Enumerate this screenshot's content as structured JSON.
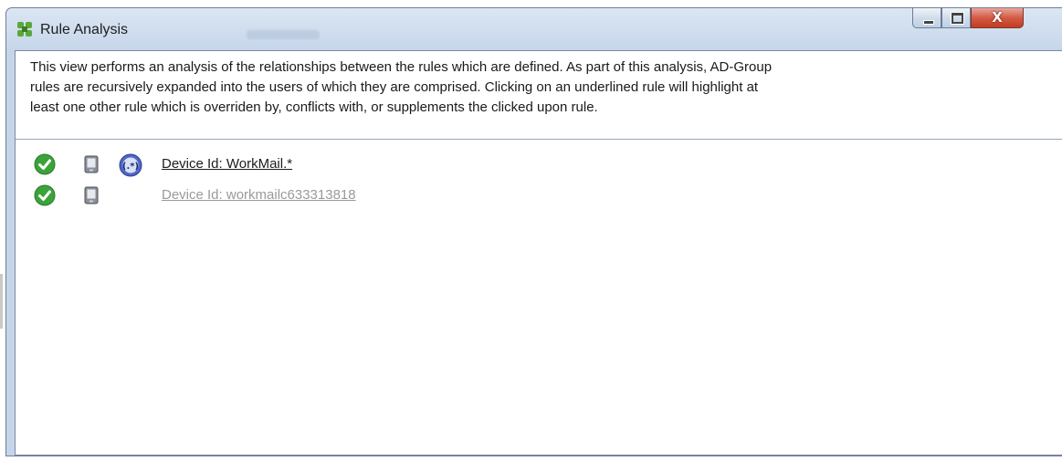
{
  "window": {
    "title": "Rule Analysis",
    "controls": {
      "minimize_icon": "minimize-icon",
      "maximize_icon": "maximize-icon",
      "close_label": "X"
    }
  },
  "description": {
    "lines": [
      "This view performs an analysis of the relationships between the rules which are defined. As part of this analysis, AD-Group",
      "rules are recursively expanded into the users of which they are comprised. Clicking on an underlined rule will highlight at",
      "least one other rule which is overriden by, conflicts with, or supplements the clicked upon rule."
    ]
  },
  "rules": [
    {
      "label": "Device Id: WorkMail.*",
      "status_icon": "check-icon",
      "type_icon": "device-icon",
      "pattern_icon": "regex-icon",
      "highlighted": true
    },
    {
      "label": "Device Id: workmailc633313818",
      "status_icon": "check-icon",
      "type_icon": "device-icon",
      "pattern_icon": null,
      "highlighted": false
    }
  ],
  "colors": {
    "check_green": "#3aa33a",
    "link_active": "#1c1c1c",
    "link_dim": "#9a9a9a",
    "close_red": "#d45a44",
    "frame_blue": "#c6d6ea"
  }
}
